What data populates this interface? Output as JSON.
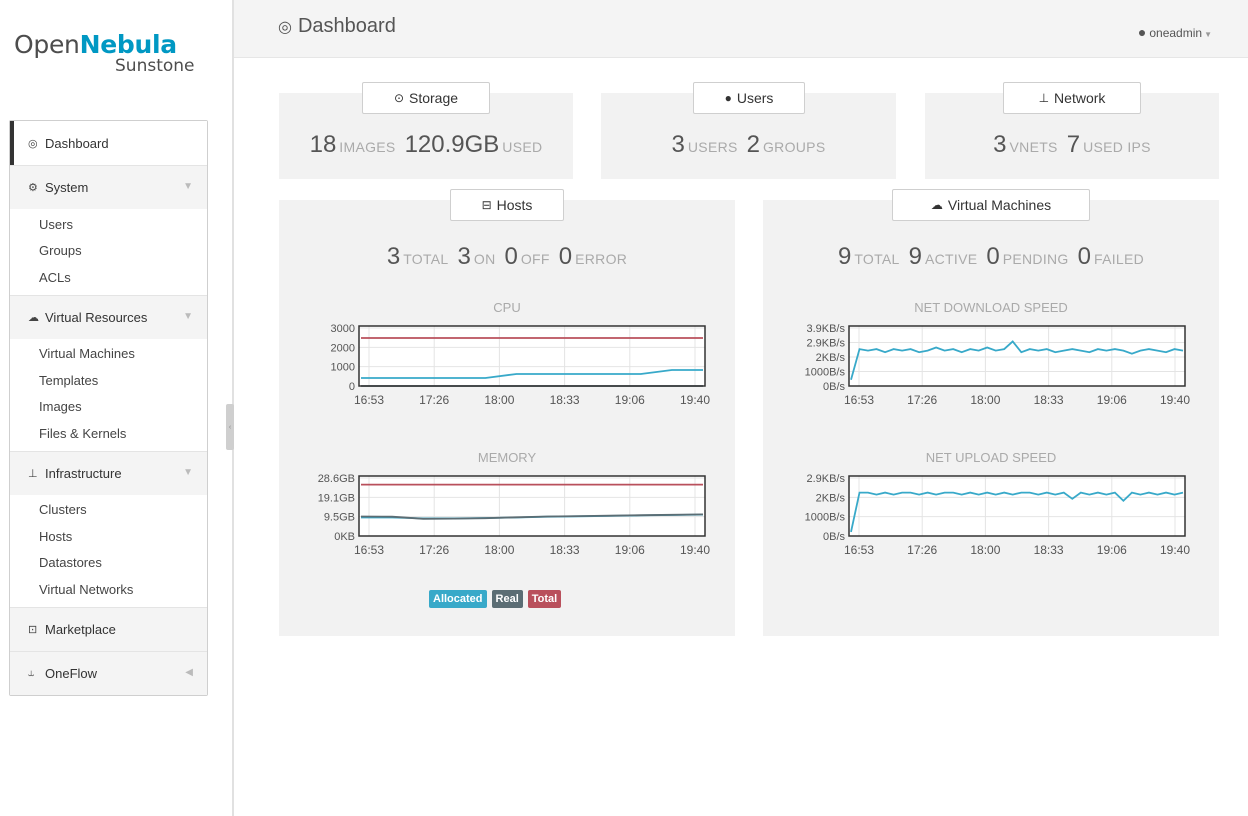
{
  "app": {
    "logo_prefix": "Open",
    "logo_brand": "Nebula",
    "logo_sub": "Sunstone"
  },
  "header": {
    "title": "Dashboard",
    "title_icon": "dashboard-icon",
    "user": "oneadmin"
  },
  "menu": {
    "dashboard": "Dashboard",
    "system": "System",
    "system_items": [
      "Users",
      "Groups",
      "ACLs"
    ],
    "virtual": "Virtual Resources",
    "virtual_items": [
      "Virtual Machines",
      "Templates",
      "Images",
      "Files & Kernels"
    ],
    "infra": "Infrastructure",
    "infra_items": [
      "Clusters",
      "Hosts",
      "Datastores",
      "Virtual Networks"
    ],
    "marketplace": "Marketplace",
    "oneflow": "OneFlow"
  },
  "storage": {
    "title": "Storage",
    "images": "18",
    "images_label": "IMAGES",
    "used": "120.9GB",
    "used_label": "USED"
  },
  "users": {
    "title": "Users",
    "users": "3",
    "users_label": "USERS",
    "groups": "2",
    "groups_label": "GROUPS"
  },
  "network": {
    "title": "Network",
    "vnets": "3",
    "vnets_label": "VNETS",
    "ips": "7",
    "ips_label": "USED IPs"
  },
  "hosts": {
    "title": "Hosts",
    "total": "3",
    "total_label": "TOTAL",
    "on": "3",
    "on_label": "ON",
    "off": "0",
    "off_label": "OFF",
    "error": "0",
    "error_label": "ERROR",
    "legend": {
      "allocated": "Allocated",
      "real": "Real",
      "total": "Total"
    }
  },
  "vms": {
    "title": "Virtual Machines",
    "total": "9",
    "total_label": "TOTAL",
    "active": "9",
    "active_label": "ACTIVE",
    "pending": "0",
    "pending_label": "PENDING",
    "failed": "0",
    "failed_label": "FAILED"
  },
  "colors": {
    "allocated": "#38a9c9",
    "real": "#5b6d74",
    "total": "#b9505c",
    "brand": "#0098c3"
  },
  "chart_data": [
    {
      "id": "cpu",
      "type": "line",
      "title": "CPU",
      "x_ticks": [
        "16:53",
        "17:26",
        "18:00",
        "18:33",
        "19:06",
        "19:40"
      ],
      "y_ticks": [
        "3000",
        "2000",
        "1000",
        "0"
      ],
      "ylim": [
        0,
        3000
      ],
      "series": [
        {
          "name": "Total",
          "color": "#b9505c",
          "values": [
            2400,
            2400,
            2400,
            2400,
            2400,
            2400,
            2400,
            2400,
            2400,
            2400,
            2400,
            2400
          ]
        },
        {
          "name": "Allocated",
          "color": "#38a9c9",
          "values": [
            400,
            400,
            400,
            400,
            400,
            600,
            600,
            600,
            600,
            600,
            800,
            800
          ]
        },
        {
          "name": "Real",
          "color": "#5b6d74",
          "values": [
            0,
            0,
            0,
            0,
            0,
            0,
            0,
            0,
            0,
            0,
            0,
            0
          ]
        }
      ]
    },
    {
      "id": "memory",
      "type": "line",
      "title": "MEMORY",
      "x_ticks": [
        "16:53",
        "17:26",
        "18:00",
        "18:33",
        "19:06",
        "19:40"
      ],
      "y_ticks": [
        "28.6GB",
        "19.1GB",
        "9.5GB",
        "0KB"
      ],
      "ylim": [
        0,
        28.6
      ],
      "series": [
        {
          "name": "Total",
          "color": "#b9505c",
          "values": [
            24.5,
            24.5,
            24.5,
            24.5,
            24.5,
            24.5,
            24.5,
            24.5,
            24.5,
            24.5,
            24.5,
            24.5
          ]
        },
        {
          "name": "Allocated",
          "color": "#38a9c9",
          "values": [
            8.8,
            8.8,
            8.4,
            8.4,
            8.6,
            8.8,
            9.2,
            9.4,
            9.6,
            9.8,
            10.0,
            10.2
          ]
        },
        {
          "name": "Real",
          "color": "#5b6d74",
          "values": [
            9.3,
            9.2,
            8.2,
            8.3,
            8.5,
            8.9,
            9.3,
            9.5,
            9.7,
            9.9,
            10.1,
            10.3
          ]
        }
      ]
    },
    {
      "id": "netdown",
      "type": "line",
      "title": "NET DOWNLOAD SPEED",
      "x_ticks": [
        "16:53",
        "17:26",
        "18:00",
        "18:33",
        "19:06",
        "19:40"
      ],
      "y_ticks": [
        "3.9KB/s",
        "2.9KB/s",
        "2KB/s",
        "1000B/s",
        "0B/s"
      ],
      "ylim": [
        0,
        3.9
      ],
      "series": [
        {
          "name": "Net download",
          "color": "#38a9c9",
          "values": [
            0.4,
            2.4,
            2.3,
            2.4,
            2.2,
            2.4,
            2.3,
            2.4,
            2.2,
            2.3,
            2.5,
            2.3,
            2.4,
            2.2,
            2.4,
            2.3,
            2.5,
            2.3,
            2.4,
            2.9,
            2.2,
            2.4,
            2.3,
            2.4,
            2.2,
            2.3,
            2.4,
            2.3,
            2.2,
            2.4,
            2.3,
            2.4,
            2.3,
            2.1,
            2.3,
            2.4,
            2.3,
            2.2,
            2.4,
            2.3
          ]
        }
      ]
    },
    {
      "id": "netup",
      "type": "line",
      "title": "NET UPLOAD SPEED",
      "x_ticks": [
        "16:53",
        "17:26",
        "18:00",
        "18:33",
        "19:06",
        "19:40"
      ],
      "y_ticks": [
        "2.9KB/s",
        "2KB/s",
        "1000B/s",
        "0B/s"
      ],
      "ylim": [
        0,
        2.9
      ],
      "series": [
        {
          "name": "Net upload",
          "color": "#38a9c9",
          "values": [
            0.2,
            2.1,
            2.1,
            2.0,
            2.1,
            2.0,
            2.1,
            2.1,
            2.0,
            2.1,
            2.0,
            2.1,
            2.1,
            2.0,
            2.1,
            2.0,
            2.1,
            2.0,
            2.1,
            2.0,
            2.1,
            2.1,
            2.0,
            2.1,
            2.0,
            2.1,
            1.8,
            2.1,
            2.0,
            2.1,
            2.0,
            2.1,
            1.7,
            2.1,
            2.0,
            2.1,
            2.0,
            2.1,
            2.0,
            2.1
          ]
        }
      ]
    }
  ]
}
